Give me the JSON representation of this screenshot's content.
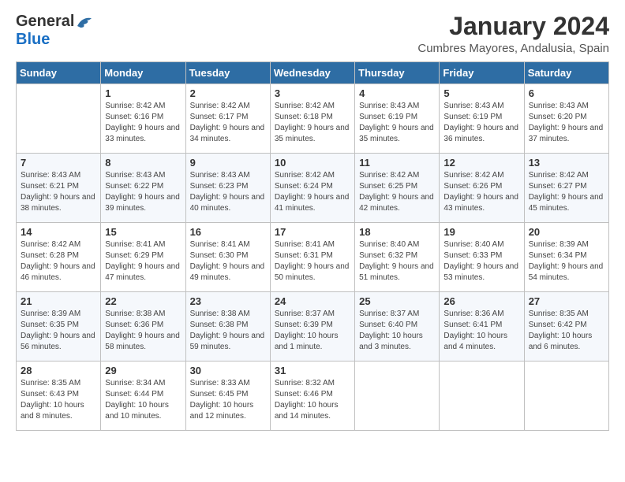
{
  "logo": {
    "general": "General",
    "blue": "Blue"
  },
  "title": "January 2024",
  "subtitle": "Cumbres Mayores, Andalusia, Spain",
  "days_header": [
    "Sunday",
    "Monday",
    "Tuesday",
    "Wednesday",
    "Thursday",
    "Friday",
    "Saturday"
  ],
  "weeks": [
    [
      {
        "day": "",
        "sunrise": "",
        "sunset": "",
        "daylight": ""
      },
      {
        "day": "1",
        "sunrise": "Sunrise: 8:42 AM",
        "sunset": "Sunset: 6:16 PM",
        "daylight": "Daylight: 9 hours and 33 minutes."
      },
      {
        "day": "2",
        "sunrise": "Sunrise: 8:42 AM",
        "sunset": "Sunset: 6:17 PM",
        "daylight": "Daylight: 9 hours and 34 minutes."
      },
      {
        "day": "3",
        "sunrise": "Sunrise: 8:42 AM",
        "sunset": "Sunset: 6:18 PM",
        "daylight": "Daylight: 9 hours and 35 minutes."
      },
      {
        "day": "4",
        "sunrise": "Sunrise: 8:43 AM",
        "sunset": "Sunset: 6:19 PM",
        "daylight": "Daylight: 9 hours and 35 minutes."
      },
      {
        "day": "5",
        "sunrise": "Sunrise: 8:43 AM",
        "sunset": "Sunset: 6:19 PM",
        "daylight": "Daylight: 9 hours and 36 minutes."
      },
      {
        "day": "6",
        "sunrise": "Sunrise: 8:43 AM",
        "sunset": "Sunset: 6:20 PM",
        "daylight": "Daylight: 9 hours and 37 minutes."
      }
    ],
    [
      {
        "day": "7",
        "sunrise": "Sunrise: 8:43 AM",
        "sunset": "Sunset: 6:21 PM",
        "daylight": "Daylight: 9 hours and 38 minutes."
      },
      {
        "day": "8",
        "sunrise": "Sunrise: 8:43 AM",
        "sunset": "Sunset: 6:22 PM",
        "daylight": "Daylight: 9 hours and 39 minutes."
      },
      {
        "day": "9",
        "sunrise": "Sunrise: 8:43 AM",
        "sunset": "Sunset: 6:23 PM",
        "daylight": "Daylight: 9 hours and 40 minutes."
      },
      {
        "day": "10",
        "sunrise": "Sunrise: 8:42 AM",
        "sunset": "Sunset: 6:24 PM",
        "daylight": "Daylight: 9 hours and 41 minutes."
      },
      {
        "day": "11",
        "sunrise": "Sunrise: 8:42 AM",
        "sunset": "Sunset: 6:25 PM",
        "daylight": "Daylight: 9 hours and 42 minutes."
      },
      {
        "day": "12",
        "sunrise": "Sunrise: 8:42 AM",
        "sunset": "Sunset: 6:26 PM",
        "daylight": "Daylight: 9 hours and 43 minutes."
      },
      {
        "day": "13",
        "sunrise": "Sunrise: 8:42 AM",
        "sunset": "Sunset: 6:27 PM",
        "daylight": "Daylight: 9 hours and 45 minutes."
      }
    ],
    [
      {
        "day": "14",
        "sunrise": "Sunrise: 8:42 AM",
        "sunset": "Sunset: 6:28 PM",
        "daylight": "Daylight: 9 hours and 46 minutes."
      },
      {
        "day": "15",
        "sunrise": "Sunrise: 8:41 AM",
        "sunset": "Sunset: 6:29 PM",
        "daylight": "Daylight: 9 hours and 47 minutes."
      },
      {
        "day": "16",
        "sunrise": "Sunrise: 8:41 AM",
        "sunset": "Sunset: 6:30 PM",
        "daylight": "Daylight: 9 hours and 49 minutes."
      },
      {
        "day": "17",
        "sunrise": "Sunrise: 8:41 AM",
        "sunset": "Sunset: 6:31 PM",
        "daylight": "Daylight: 9 hours and 50 minutes."
      },
      {
        "day": "18",
        "sunrise": "Sunrise: 8:40 AM",
        "sunset": "Sunset: 6:32 PM",
        "daylight": "Daylight: 9 hours and 51 minutes."
      },
      {
        "day": "19",
        "sunrise": "Sunrise: 8:40 AM",
        "sunset": "Sunset: 6:33 PM",
        "daylight": "Daylight: 9 hours and 53 minutes."
      },
      {
        "day": "20",
        "sunrise": "Sunrise: 8:39 AM",
        "sunset": "Sunset: 6:34 PM",
        "daylight": "Daylight: 9 hours and 54 minutes."
      }
    ],
    [
      {
        "day": "21",
        "sunrise": "Sunrise: 8:39 AM",
        "sunset": "Sunset: 6:35 PM",
        "daylight": "Daylight: 9 hours and 56 minutes."
      },
      {
        "day": "22",
        "sunrise": "Sunrise: 8:38 AM",
        "sunset": "Sunset: 6:36 PM",
        "daylight": "Daylight: 9 hours and 58 minutes."
      },
      {
        "day": "23",
        "sunrise": "Sunrise: 8:38 AM",
        "sunset": "Sunset: 6:38 PM",
        "daylight": "Daylight: 9 hours and 59 minutes."
      },
      {
        "day": "24",
        "sunrise": "Sunrise: 8:37 AM",
        "sunset": "Sunset: 6:39 PM",
        "daylight": "Daylight: 10 hours and 1 minute."
      },
      {
        "day": "25",
        "sunrise": "Sunrise: 8:37 AM",
        "sunset": "Sunset: 6:40 PM",
        "daylight": "Daylight: 10 hours and 3 minutes."
      },
      {
        "day": "26",
        "sunrise": "Sunrise: 8:36 AM",
        "sunset": "Sunset: 6:41 PM",
        "daylight": "Daylight: 10 hours and 4 minutes."
      },
      {
        "day": "27",
        "sunrise": "Sunrise: 8:35 AM",
        "sunset": "Sunset: 6:42 PM",
        "daylight": "Daylight: 10 hours and 6 minutes."
      }
    ],
    [
      {
        "day": "28",
        "sunrise": "Sunrise: 8:35 AM",
        "sunset": "Sunset: 6:43 PM",
        "daylight": "Daylight: 10 hours and 8 minutes."
      },
      {
        "day": "29",
        "sunrise": "Sunrise: 8:34 AM",
        "sunset": "Sunset: 6:44 PM",
        "daylight": "Daylight: 10 hours and 10 minutes."
      },
      {
        "day": "30",
        "sunrise": "Sunrise: 8:33 AM",
        "sunset": "Sunset: 6:45 PM",
        "daylight": "Daylight: 10 hours and 12 minutes."
      },
      {
        "day": "31",
        "sunrise": "Sunrise: 8:32 AM",
        "sunset": "Sunset: 6:46 PM",
        "daylight": "Daylight: 10 hours and 14 minutes."
      },
      {
        "day": "",
        "sunrise": "",
        "sunset": "",
        "daylight": ""
      },
      {
        "day": "",
        "sunrise": "",
        "sunset": "",
        "daylight": ""
      },
      {
        "day": "",
        "sunrise": "",
        "sunset": "",
        "daylight": ""
      }
    ]
  ]
}
